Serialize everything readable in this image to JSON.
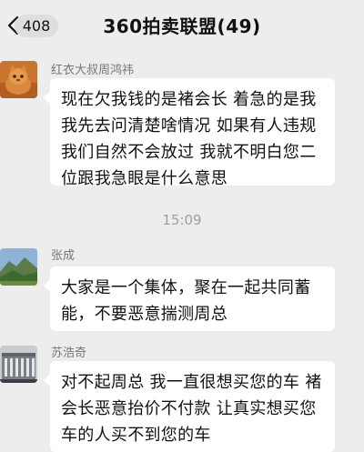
{
  "header": {
    "unread_count": "408",
    "title": "360拍卖联盟(49)"
  },
  "messages": [
    {
      "sender": "红衣大叔周鸿祎",
      "text": "现在欠我钱的是褚会长 着急的是我我先去问清楚啥情况 如果有人违规我们自然不会放过 我就不明白您二位跟我急眼是什么意思",
      "avatar": "cat-avatar"
    },
    {
      "sender": "张成",
      "text": "大家是一个集体，聚在一起共同蓄能，不要恶意揣测周总",
      "avatar": "landscape-avatar"
    },
    {
      "sender": "苏浩奇",
      "text": "对不起周总 我一直很想买您的车 褚会长恶意抬价不付款 让真实想买您车的人买不到您的车",
      "avatar": "building-avatar"
    }
  ],
  "timestamp": "15:09"
}
